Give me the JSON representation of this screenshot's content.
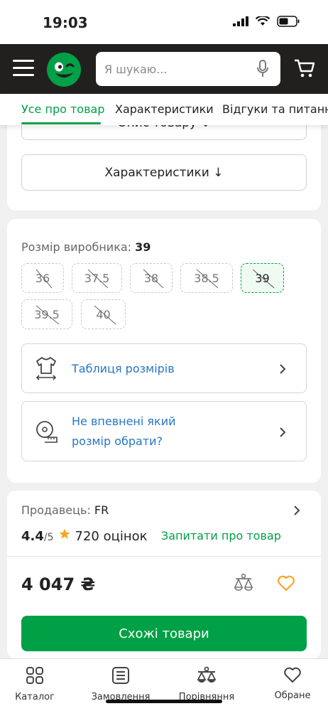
{
  "status_bar": {
    "time": "19:03"
  },
  "header": {
    "search_placeholder": "Я шукаю..."
  },
  "tabs": [
    {
      "label": "Усе про товар",
      "active": true
    },
    {
      "label": "Характеристики",
      "active": false
    },
    {
      "label": "Відгуки та питання",
      "active": false
    }
  ],
  "description_button": "Опис товару ↓",
  "characteristics_button": "Характеристики ↓",
  "sizes": {
    "label": "Розмір виробника:",
    "selected_value": "39",
    "options": [
      {
        "value": "36",
        "available": false,
        "selected": false
      },
      {
        "value": "37.5",
        "available": false,
        "selected": false
      },
      {
        "value": "38",
        "available": false,
        "selected": false
      },
      {
        "value": "38.5",
        "available": false,
        "selected": false
      },
      {
        "value": "39",
        "available": false,
        "selected": true
      },
      {
        "value": "39.5",
        "available": false,
        "selected": false
      },
      {
        "value": "40",
        "available": false,
        "selected": false
      }
    ]
  },
  "size_table_link": "Таблиця розмірів",
  "size_help_link": {
    "line1": "Не впевнені який",
    "line2": "розмір обрати?"
  },
  "seller": {
    "label": "Продавець:",
    "name": "FR"
  },
  "rating": {
    "score": "4.4",
    "max": "/5",
    "count_text": "720 оцінок"
  },
  "ask_link": "Запитати про товар",
  "price": "4 047 ₴",
  "similar_button": "Схожі товари",
  "bottom_nav": [
    {
      "label": "Каталог",
      "icon": "catalog-icon"
    },
    {
      "label": "Замовлення",
      "icon": "orders-icon"
    },
    {
      "label": "Порівняння",
      "icon": "compare-icon"
    },
    {
      "label": "Обране",
      "icon": "heart-icon"
    }
  ],
  "colors": {
    "accent": "#00a046",
    "link": "#2776c8",
    "header_bg": "#221f1f",
    "star": "#f5a623"
  }
}
